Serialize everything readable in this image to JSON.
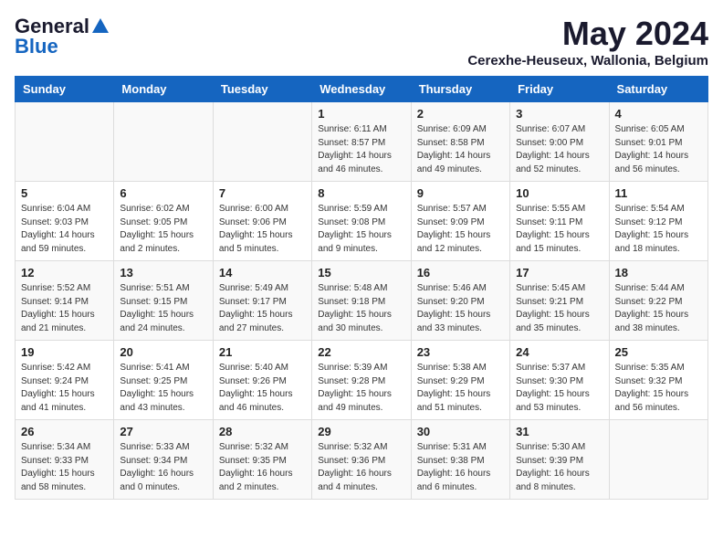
{
  "logo": {
    "general": "General",
    "blue": "Blue"
  },
  "title": "May 2024",
  "location": "Cerexhe-Heuseux, Wallonia, Belgium",
  "days_of_week": [
    "Sunday",
    "Monday",
    "Tuesday",
    "Wednesday",
    "Thursday",
    "Friday",
    "Saturday"
  ],
  "weeks": [
    [
      {
        "day": "",
        "content": ""
      },
      {
        "day": "",
        "content": ""
      },
      {
        "day": "",
        "content": ""
      },
      {
        "day": "1",
        "content": "Sunrise: 6:11 AM\nSunset: 8:57 PM\nDaylight: 14 hours and 46 minutes."
      },
      {
        "day": "2",
        "content": "Sunrise: 6:09 AM\nSunset: 8:58 PM\nDaylight: 14 hours and 49 minutes."
      },
      {
        "day": "3",
        "content": "Sunrise: 6:07 AM\nSunset: 9:00 PM\nDaylight: 14 hours and 52 minutes."
      },
      {
        "day": "4",
        "content": "Sunrise: 6:05 AM\nSunset: 9:01 PM\nDaylight: 14 hours and 56 minutes."
      }
    ],
    [
      {
        "day": "5",
        "content": "Sunrise: 6:04 AM\nSunset: 9:03 PM\nDaylight: 14 hours and 59 minutes."
      },
      {
        "day": "6",
        "content": "Sunrise: 6:02 AM\nSunset: 9:05 PM\nDaylight: 15 hours and 2 minutes."
      },
      {
        "day": "7",
        "content": "Sunrise: 6:00 AM\nSunset: 9:06 PM\nDaylight: 15 hours and 5 minutes."
      },
      {
        "day": "8",
        "content": "Sunrise: 5:59 AM\nSunset: 9:08 PM\nDaylight: 15 hours and 9 minutes."
      },
      {
        "day": "9",
        "content": "Sunrise: 5:57 AM\nSunset: 9:09 PM\nDaylight: 15 hours and 12 minutes."
      },
      {
        "day": "10",
        "content": "Sunrise: 5:55 AM\nSunset: 9:11 PM\nDaylight: 15 hours and 15 minutes."
      },
      {
        "day": "11",
        "content": "Sunrise: 5:54 AM\nSunset: 9:12 PM\nDaylight: 15 hours and 18 minutes."
      }
    ],
    [
      {
        "day": "12",
        "content": "Sunrise: 5:52 AM\nSunset: 9:14 PM\nDaylight: 15 hours and 21 minutes."
      },
      {
        "day": "13",
        "content": "Sunrise: 5:51 AM\nSunset: 9:15 PM\nDaylight: 15 hours and 24 minutes."
      },
      {
        "day": "14",
        "content": "Sunrise: 5:49 AM\nSunset: 9:17 PM\nDaylight: 15 hours and 27 minutes."
      },
      {
        "day": "15",
        "content": "Sunrise: 5:48 AM\nSunset: 9:18 PM\nDaylight: 15 hours and 30 minutes."
      },
      {
        "day": "16",
        "content": "Sunrise: 5:46 AM\nSunset: 9:20 PM\nDaylight: 15 hours and 33 minutes."
      },
      {
        "day": "17",
        "content": "Sunrise: 5:45 AM\nSunset: 9:21 PM\nDaylight: 15 hours and 35 minutes."
      },
      {
        "day": "18",
        "content": "Sunrise: 5:44 AM\nSunset: 9:22 PM\nDaylight: 15 hours and 38 minutes."
      }
    ],
    [
      {
        "day": "19",
        "content": "Sunrise: 5:42 AM\nSunset: 9:24 PM\nDaylight: 15 hours and 41 minutes."
      },
      {
        "day": "20",
        "content": "Sunrise: 5:41 AM\nSunset: 9:25 PM\nDaylight: 15 hours and 43 minutes."
      },
      {
        "day": "21",
        "content": "Sunrise: 5:40 AM\nSunset: 9:26 PM\nDaylight: 15 hours and 46 minutes."
      },
      {
        "day": "22",
        "content": "Sunrise: 5:39 AM\nSunset: 9:28 PM\nDaylight: 15 hours and 49 minutes."
      },
      {
        "day": "23",
        "content": "Sunrise: 5:38 AM\nSunset: 9:29 PM\nDaylight: 15 hours and 51 minutes."
      },
      {
        "day": "24",
        "content": "Sunrise: 5:37 AM\nSunset: 9:30 PM\nDaylight: 15 hours and 53 minutes."
      },
      {
        "day": "25",
        "content": "Sunrise: 5:35 AM\nSunset: 9:32 PM\nDaylight: 15 hours and 56 minutes."
      }
    ],
    [
      {
        "day": "26",
        "content": "Sunrise: 5:34 AM\nSunset: 9:33 PM\nDaylight: 15 hours and 58 minutes."
      },
      {
        "day": "27",
        "content": "Sunrise: 5:33 AM\nSunset: 9:34 PM\nDaylight: 16 hours and 0 minutes."
      },
      {
        "day": "28",
        "content": "Sunrise: 5:32 AM\nSunset: 9:35 PM\nDaylight: 16 hours and 2 minutes."
      },
      {
        "day": "29",
        "content": "Sunrise: 5:32 AM\nSunset: 9:36 PM\nDaylight: 16 hours and 4 minutes."
      },
      {
        "day": "30",
        "content": "Sunrise: 5:31 AM\nSunset: 9:38 PM\nDaylight: 16 hours and 6 minutes."
      },
      {
        "day": "31",
        "content": "Sunrise: 5:30 AM\nSunset: 9:39 PM\nDaylight: 16 hours and 8 minutes."
      },
      {
        "day": "",
        "content": ""
      }
    ]
  ]
}
